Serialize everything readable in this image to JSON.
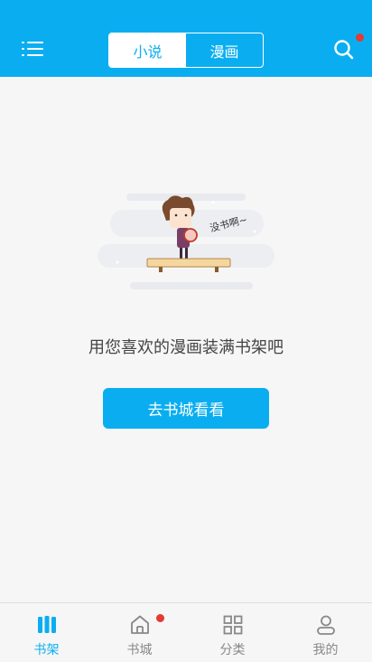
{
  "colors": {
    "accent": "#0aaef0",
    "badge": "#e53935",
    "background": "#f6f6f6"
  },
  "header": {
    "menu_icon": "menu-list-icon",
    "tabs": [
      {
        "label": "小说",
        "active": true
      },
      {
        "label": "漫画",
        "active": false
      }
    ],
    "search_icon": "search-icon",
    "search_badge": true
  },
  "empty_state": {
    "illustration_text": "没书啊~",
    "message": "用您喜欢的漫画装满书架吧",
    "button_label": "去书城看看"
  },
  "bottom_nav": [
    {
      "label": "书架",
      "icon": "bookshelf-icon",
      "active": true,
      "badge": false
    },
    {
      "label": "书城",
      "icon": "home-icon",
      "active": false,
      "badge": true
    },
    {
      "label": "分类",
      "icon": "category-grid-icon",
      "active": false,
      "badge": false
    },
    {
      "label": "我的",
      "icon": "profile-icon",
      "active": false,
      "badge": false
    }
  ]
}
